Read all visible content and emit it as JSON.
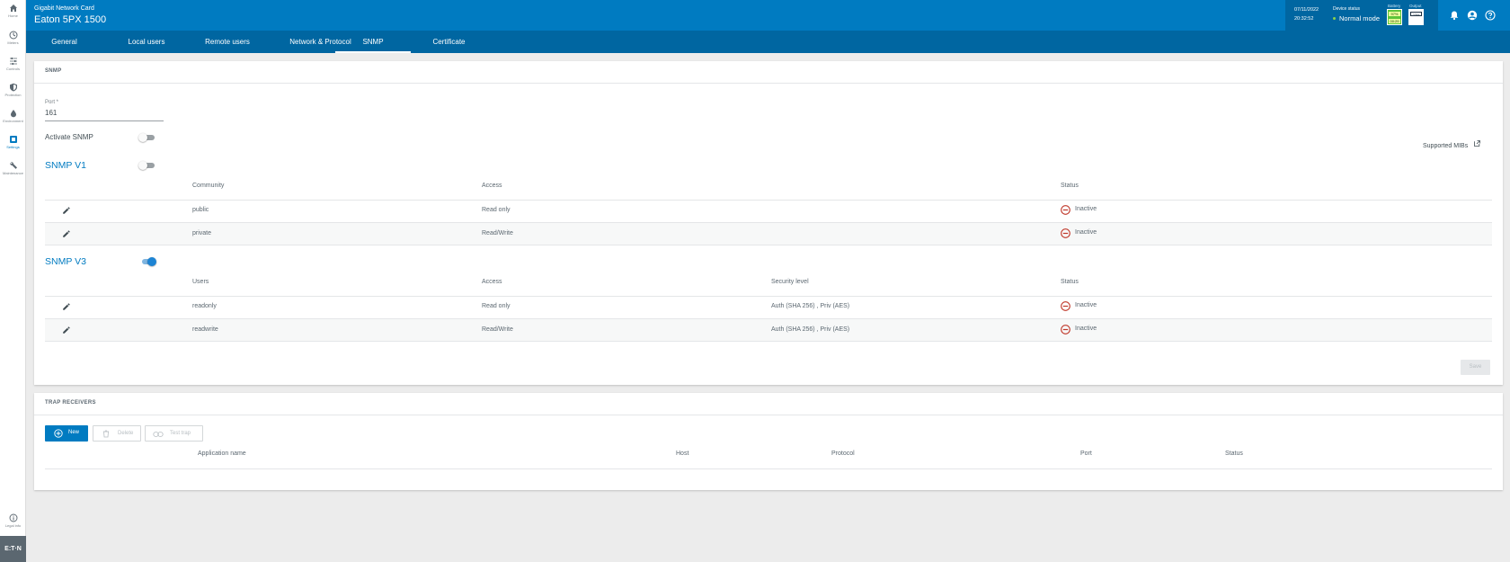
{
  "nav": {
    "items": [
      {
        "label": "Home",
        "icon": "home-icon"
      },
      {
        "label": "Meters",
        "icon": "gauge-icon"
      },
      {
        "label": "Controls",
        "icon": "sliders-icon"
      },
      {
        "label": "Protection",
        "icon": "shield-icon"
      },
      {
        "label": "Environment",
        "icon": "drop-icon"
      },
      {
        "label": "Settings",
        "icon": "settings-icon",
        "active": true
      },
      {
        "label": "Maintenance",
        "icon": "wrench-icon"
      }
    ],
    "legal_label": "Legal info",
    "logo_text": "E:T·N"
  },
  "header": {
    "subtitle": "Gigabit Network Card",
    "title": "Eaton 5PX 1500",
    "date": "07/11/2022",
    "time": "20:32:52",
    "device_status_label": "Device status",
    "device_status_value": "Normal mode",
    "battery_label": "Battery",
    "battery_pct": "97%",
    "battery_time": "00:29",
    "output_label": "Output",
    "output_pct": "23%"
  },
  "tabs": [
    "General",
    "Local users",
    "Remote users",
    "Network & Protocol",
    "SNMP",
    "Certificate"
  ],
  "active_tab": "SNMP",
  "snmp": {
    "card_title": "SNMP",
    "port_label": "Port *",
    "port_value": "161",
    "activate_label": "Activate SNMP",
    "supported_mibs": "Supported MIBs",
    "v1": {
      "title": "SNMP V1",
      "enabled": false,
      "headers": {
        "community": "Community",
        "access": "Access",
        "status": "Status"
      },
      "rows": [
        {
          "community": "public",
          "access": "Read only",
          "status": "Inactive"
        },
        {
          "community": "private",
          "access": "Read/Write",
          "status": "Inactive"
        }
      ]
    },
    "v3": {
      "title": "SNMP V3",
      "enabled": true,
      "headers": {
        "users": "Users",
        "access": "Access",
        "security": "Security level",
        "status": "Status"
      },
      "rows": [
        {
          "user": "readonly",
          "access": "Read only",
          "security": "Auth (SHA 256) , Priv (AES)",
          "status": "Inactive"
        },
        {
          "user": "readwrite",
          "access": "Read/Write",
          "security": "Auth (SHA 256) , Priv (AES)",
          "status": "Inactive"
        }
      ]
    },
    "save_label": "Save"
  },
  "trap": {
    "card_title": "TRAP RECEIVERS",
    "new_label": "New",
    "delete_label": "Delete",
    "test_label": "Test trap",
    "headers": {
      "app": "Application name",
      "host": "Host",
      "protocol": "Protocol",
      "port": "Port",
      "status": "Status"
    }
  },
  "colors": {
    "brand": "#007bc1",
    "brand_dark": "#0066a1",
    "inactive": "#c0392b",
    "battery": "#5cc43a"
  }
}
